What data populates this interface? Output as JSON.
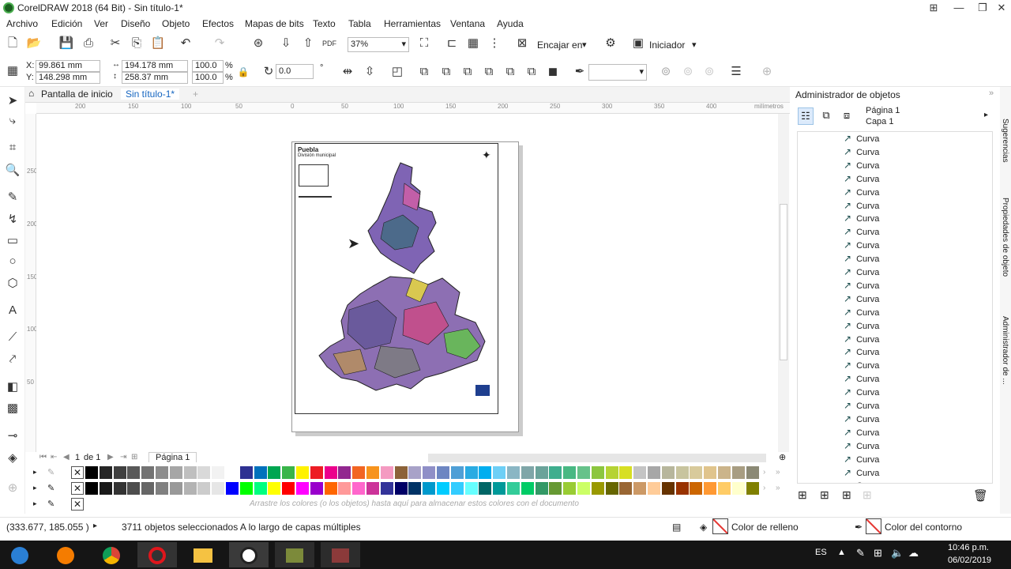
{
  "window": {
    "title": "CorelDRAW 2018 (64 Bit) - Sin título-1*"
  },
  "menu": [
    "Archivo",
    "Edición",
    "Ver",
    "Diseño",
    "Objeto",
    "Efectos",
    "Mapas de bits",
    "Texto",
    "Tabla",
    "Herramientas",
    "Ventana",
    "Ayuda"
  ],
  "standard_toolbar": {
    "zoom": "37%",
    "snap_label": "Encajar en",
    "launch_label": "Iniciador"
  },
  "property_bar": {
    "x_label": "X:",
    "x": "99.861 mm",
    "y_label": "Y:",
    "y": "148.298 mm",
    "width": "194.178 mm",
    "height": "258.37 mm",
    "scale_x": "100.0",
    "scale_y": "100.0",
    "percent": "%",
    "rotation": "0.0"
  },
  "doc_tabs": {
    "home": "Pantalla de inicio",
    "doc": "Sin título-1*"
  },
  "ruler": {
    "unit": "milímetros",
    "h_ticks": [
      "200",
      "150",
      "100",
      "50",
      "0",
      "50",
      "100",
      "150",
      "200",
      "250",
      "300",
      "350",
      "400"
    ],
    "v_ticks": [
      "250",
      "200",
      "150",
      "100",
      "50"
    ]
  },
  "page_nav": {
    "current": "1",
    "of": "de 1",
    "page_tab": "Página 1"
  },
  "map": {
    "title": "Puebla",
    "subtitle": "División municipal"
  },
  "palette": {
    "row1": [
      "#000000",
      "#262626",
      "#404040",
      "#595959",
      "#737373",
      "#8c8c8c",
      "#a6a6a6",
      "#bfbfbf",
      "#d9d9d9",
      "#f2f2f2",
      "#ffffff",
      "#2e3192",
      "#0071bc",
      "#00a651",
      "#39b54a",
      "#fff200",
      "#ed1c24",
      "#ec008c",
      "#92278f",
      "#f26522",
      "#f7941d",
      "#f49ac1",
      "#8c6239",
      "#a8a2c8",
      "#8f8fc7",
      "#6d86c2",
      "#4f9fd6",
      "#29abe2",
      "#00aeef",
      "#6dcff6",
      "#8ab6c4",
      "#7fa6a8",
      "#6aa39a",
      "#3fae8e",
      "#48b883",
      "#66c28a",
      "#8cc63f",
      "#b5d334",
      "#d7df23",
      "#c4c4c4",
      "#a7a7a7",
      "#b7b69c",
      "#c8c49e",
      "#d8ca9b",
      "#e0c48c",
      "#cbb48a",
      "#a89d82",
      "#8b8975"
    ],
    "row2": [
      "#000000",
      "#1a1a1a",
      "#333333",
      "#4d4d4d",
      "#666666",
      "#808080",
      "#999999",
      "#b3b3b3",
      "#cccccc",
      "#e6e6e6",
      "#0000ff",
      "#00ff00",
      "#00ff80",
      "#ffff00",
      "#ff0000",
      "#ff00ff",
      "#9900cc",
      "#ff6600",
      "#ff9999",
      "#ff66cc",
      "#cc3399",
      "#333399",
      "#000066",
      "#003366",
      "#0099cc",
      "#00ccff",
      "#33ccff",
      "#66ffff",
      "#006666",
      "#009999",
      "#33cc99",
      "#00cc66",
      "#339966",
      "#669933",
      "#99cc33",
      "#ccff66",
      "#999900",
      "#666600",
      "#996633",
      "#cc9966",
      "#ffcc99",
      "#663300",
      "#993300",
      "#cc6600",
      "#ff9933",
      "#ffcc66",
      "#ffffcc",
      "#808000"
    ],
    "drag_message": "Arrastre los colores (o los objetos) hasta aquí para almacenar estos colores con el documento"
  },
  "object_manager": {
    "title": "Administrador de objetos",
    "page": "Página 1",
    "layer": "Capa 1",
    "items": [
      "Curva",
      "Curva",
      "Curva",
      "Curva",
      "Curva",
      "Curva",
      "Curva",
      "Curva",
      "Curva",
      "Curva",
      "Curva",
      "Curva",
      "Curva",
      "Curva",
      "Curva",
      "Curva",
      "Curva",
      "Curva",
      "Curva",
      "Curva",
      "Curva",
      "Curva",
      "Curva",
      "Curva",
      "Curva",
      "Curva",
      "Curva"
    ]
  },
  "side_tabs": [
    "Sugerencias",
    "Propiedades de objeto",
    "Administrador de ..."
  ],
  "status": {
    "coords": "(333.677, 185.055 )",
    "selection": "3711 objetos seleccionados A lo largo de capas múltiples",
    "fill_label": "Color de relleno",
    "outline_label": "Color del contorno"
  },
  "taskbar": {
    "lang": "ES",
    "time": "10:46 p.m.",
    "date": "06/02/2019"
  }
}
